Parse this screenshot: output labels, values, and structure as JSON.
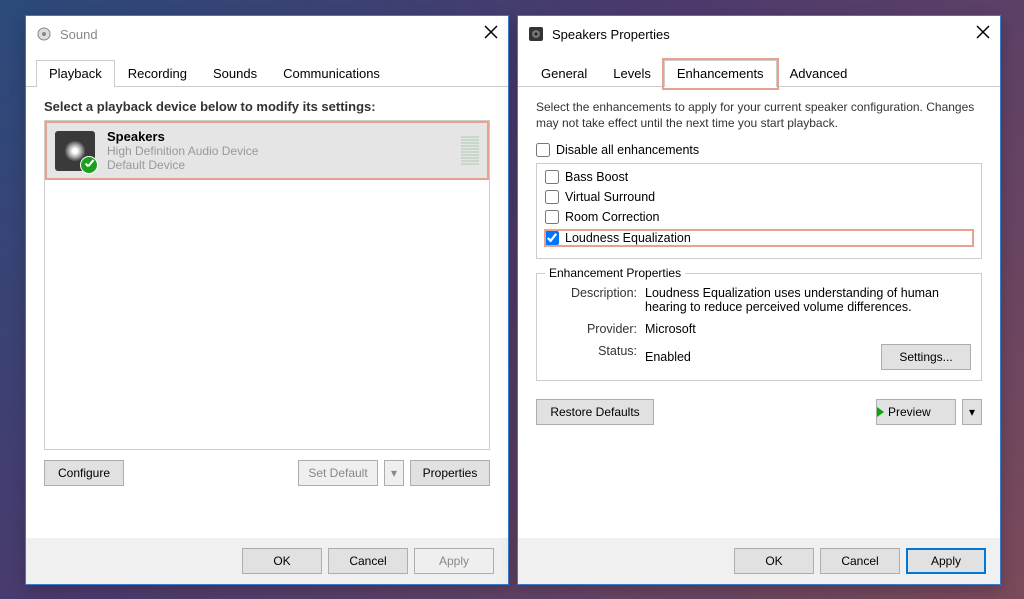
{
  "sound": {
    "title": "Sound",
    "tabs": [
      "Playback",
      "Recording",
      "Sounds",
      "Communications"
    ],
    "active_tab": 0,
    "prompt": "Select a playback device below to modify its settings:",
    "device": {
      "name": "Speakers",
      "desc": "High Definition Audio Device",
      "status": "Default Device"
    },
    "btn_configure": "Configure",
    "btn_setdefault": "Set Default",
    "btn_properties": "Properties",
    "btn_ok": "OK",
    "btn_cancel": "Cancel",
    "btn_apply": "Apply"
  },
  "props": {
    "title": "Speakers Properties",
    "tabs": [
      "General",
      "Levels",
      "Enhancements",
      "Advanced"
    ],
    "active_tab": 2,
    "intro": "Select the enhancements to apply for your current speaker configuration. Changes may not take effect until the next time you start playback.",
    "disable_label": "Disable all enhancements",
    "disable_checked": false,
    "enhancements": [
      {
        "label": "Bass Boost",
        "checked": false
      },
      {
        "label": "Virtual Surround",
        "checked": false
      },
      {
        "label": "Room Correction",
        "checked": false
      },
      {
        "label": "Loudness Equalization",
        "checked": true
      }
    ],
    "props_legend": "Enhancement Properties",
    "description_lbl": "Description:",
    "description_val": "Loudness Equalization uses understanding of human hearing to reduce perceived volume differences.",
    "provider_lbl": "Provider:",
    "provider_val": "Microsoft",
    "status_lbl": "Status:",
    "status_val": "Enabled",
    "btn_settings": "Settings...",
    "btn_restore": "Restore Defaults",
    "btn_preview": "Preview",
    "btn_ok": "OK",
    "btn_cancel": "Cancel",
    "btn_apply": "Apply"
  }
}
